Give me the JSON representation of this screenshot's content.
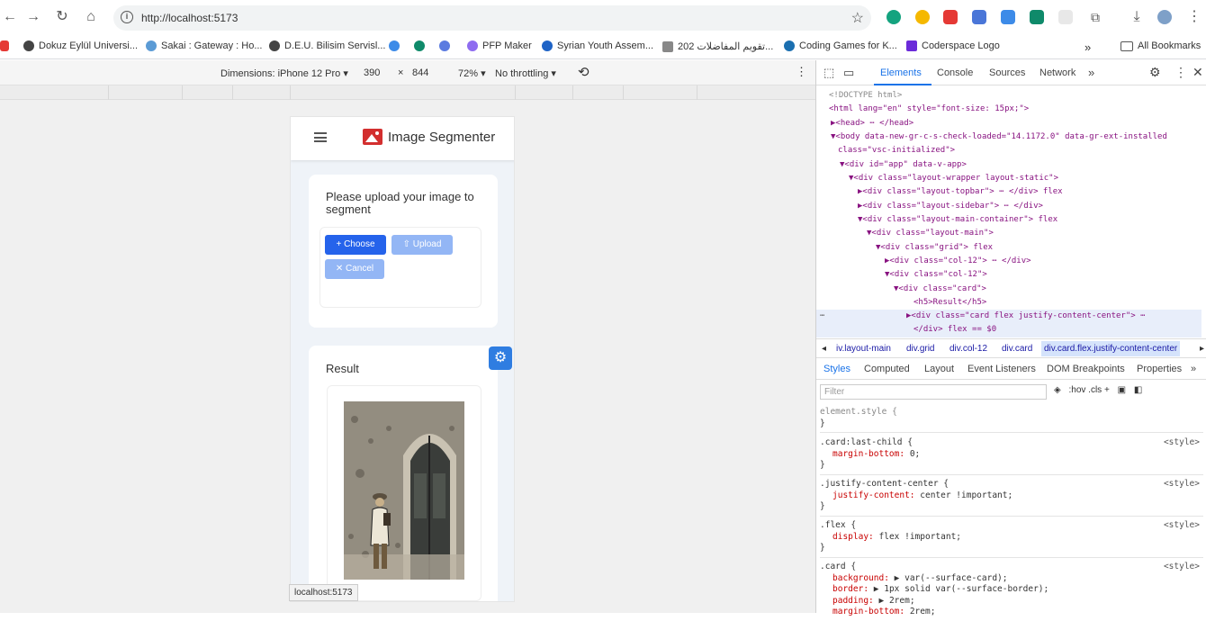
{
  "browser": {
    "url": "http://localhost:5173",
    "bookmarks": [
      "Dokuz Eylül Universi...",
      "Sakai : Gateway : Ho...",
      "D.E.U. Bilisim Servisl...",
      "PFP Maker",
      "Syrian Youth Assem...",
      "تقويم المفاضلات 202...",
      "Coding Games for K...",
      "Coderspace Logo"
    ],
    "more_label": "»",
    "all_bookmarks": "All Bookmarks"
  },
  "device_toolbar": {
    "dimensions": "Dimensions: iPhone 12 Pro ▾",
    "width": "390",
    "times": "×",
    "height": "844",
    "zoom": "72% ▾",
    "throttling": "No throttling ▾"
  },
  "app": {
    "title": "Image Segmenter",
    "upload_prompt": "Please upload your image to segment",
    "choose": "+ Choose",
    "upload": "⇧ Upload",
    "cancel": "✕ Cancel",
    "result_title": "Result"
  },
  "status_url": "localhost:5173",
  "devtools": {
    "tabs": [
      "Elements",
      "Console",
      "Sources",
      "Network",
      "»"
    ],
    "dom_lines": [
      "<!DOCTYPE html>",
      "<html lang=\"en\" style=\"font-size: 15px;\">",
      "▶<head> ⋯ </head>",
      "▼<body data-new-gr-c-s-check-loaded=\"14.1172.0\" data-gr-ext-installed",
      "class=\"vsc-initialized\">",
      "▼<div id=\"app\" data-v-app>",
      "▼<div class=\"layout-wrapper layout-static\">",
      "▶<div class=\"layout-topbar\"> ⋯ </div> flex",
      "▶<div class=\"layout-sidebar\"> ⋯ </div>",
      "▼<div class=\"layout-main-container\"> flex",
      "▼<div class=\"layout-main\">",
      "▼<div class=\"grid\"> flex",
      "▶<div class=\"col-12\"> ⋯ </div>",
      "▼<div class=\"col-12\">",
      "▼<div class=\"card\">",
      "<h5>Result</h5>",
      "▶<div class=\"card flex justify-content-center\"> ⋯",
      "</div> flex == $0"
    ],
    "breadcrumbs": [
      "◂",
      "iv.layout-main",
      "div.grid",
      "div.col-12",
      "div.card",
      "div.card.flex.justify-content-center",
      "▸"
    ],
    "subtabs": [
      "Styles",
      "Computed",
      "Layout",
      "Event Listeners",
      "DOM Breakpoints",
      "Properties",
      "»"
    ],
    "filter_placeholder": "Filter",
    "filter_tools": ":hov  .cls  +",
    "rules": [
      {
        "selector": "element.style {",
        "source": "",
        "props": [],
        "close": "}"
      },
      {
        "selector": ".card:last-child {",
        "source": "<style>",
        "props": [
          [
            "margin-bottom",
            " 0;"
          ]
        ],
        "close": "}"
      },
      {
        "selector": ".justify-content-center {",
        "source": "<style>",
        "props": [
          [
            "justify-content",
            " center !important;"
          ]
        ],
        "close": "}"
      },
      {
        "selector": ".flex {",
        "source": "<style>",
        "props": [
          [
            "display",
            " flex !important;"
          ]
        ],
        "close": "}"
      },
      {
        "selector": ".card {",
        "source": "<style>",
        "props": [
          [
            "background",
            " ▶ var(--surface-card);"
          ],
          [
            "border",
            " ▶ 1px solid var(--surface-border);"
          ],
          [
            "padding",
            " ▶ 2rem;"
          ],
          [
            "margin-bottom",
            " 2rem;"
          ]
        ],
        "close": ""
      }
    ]
  }
}
